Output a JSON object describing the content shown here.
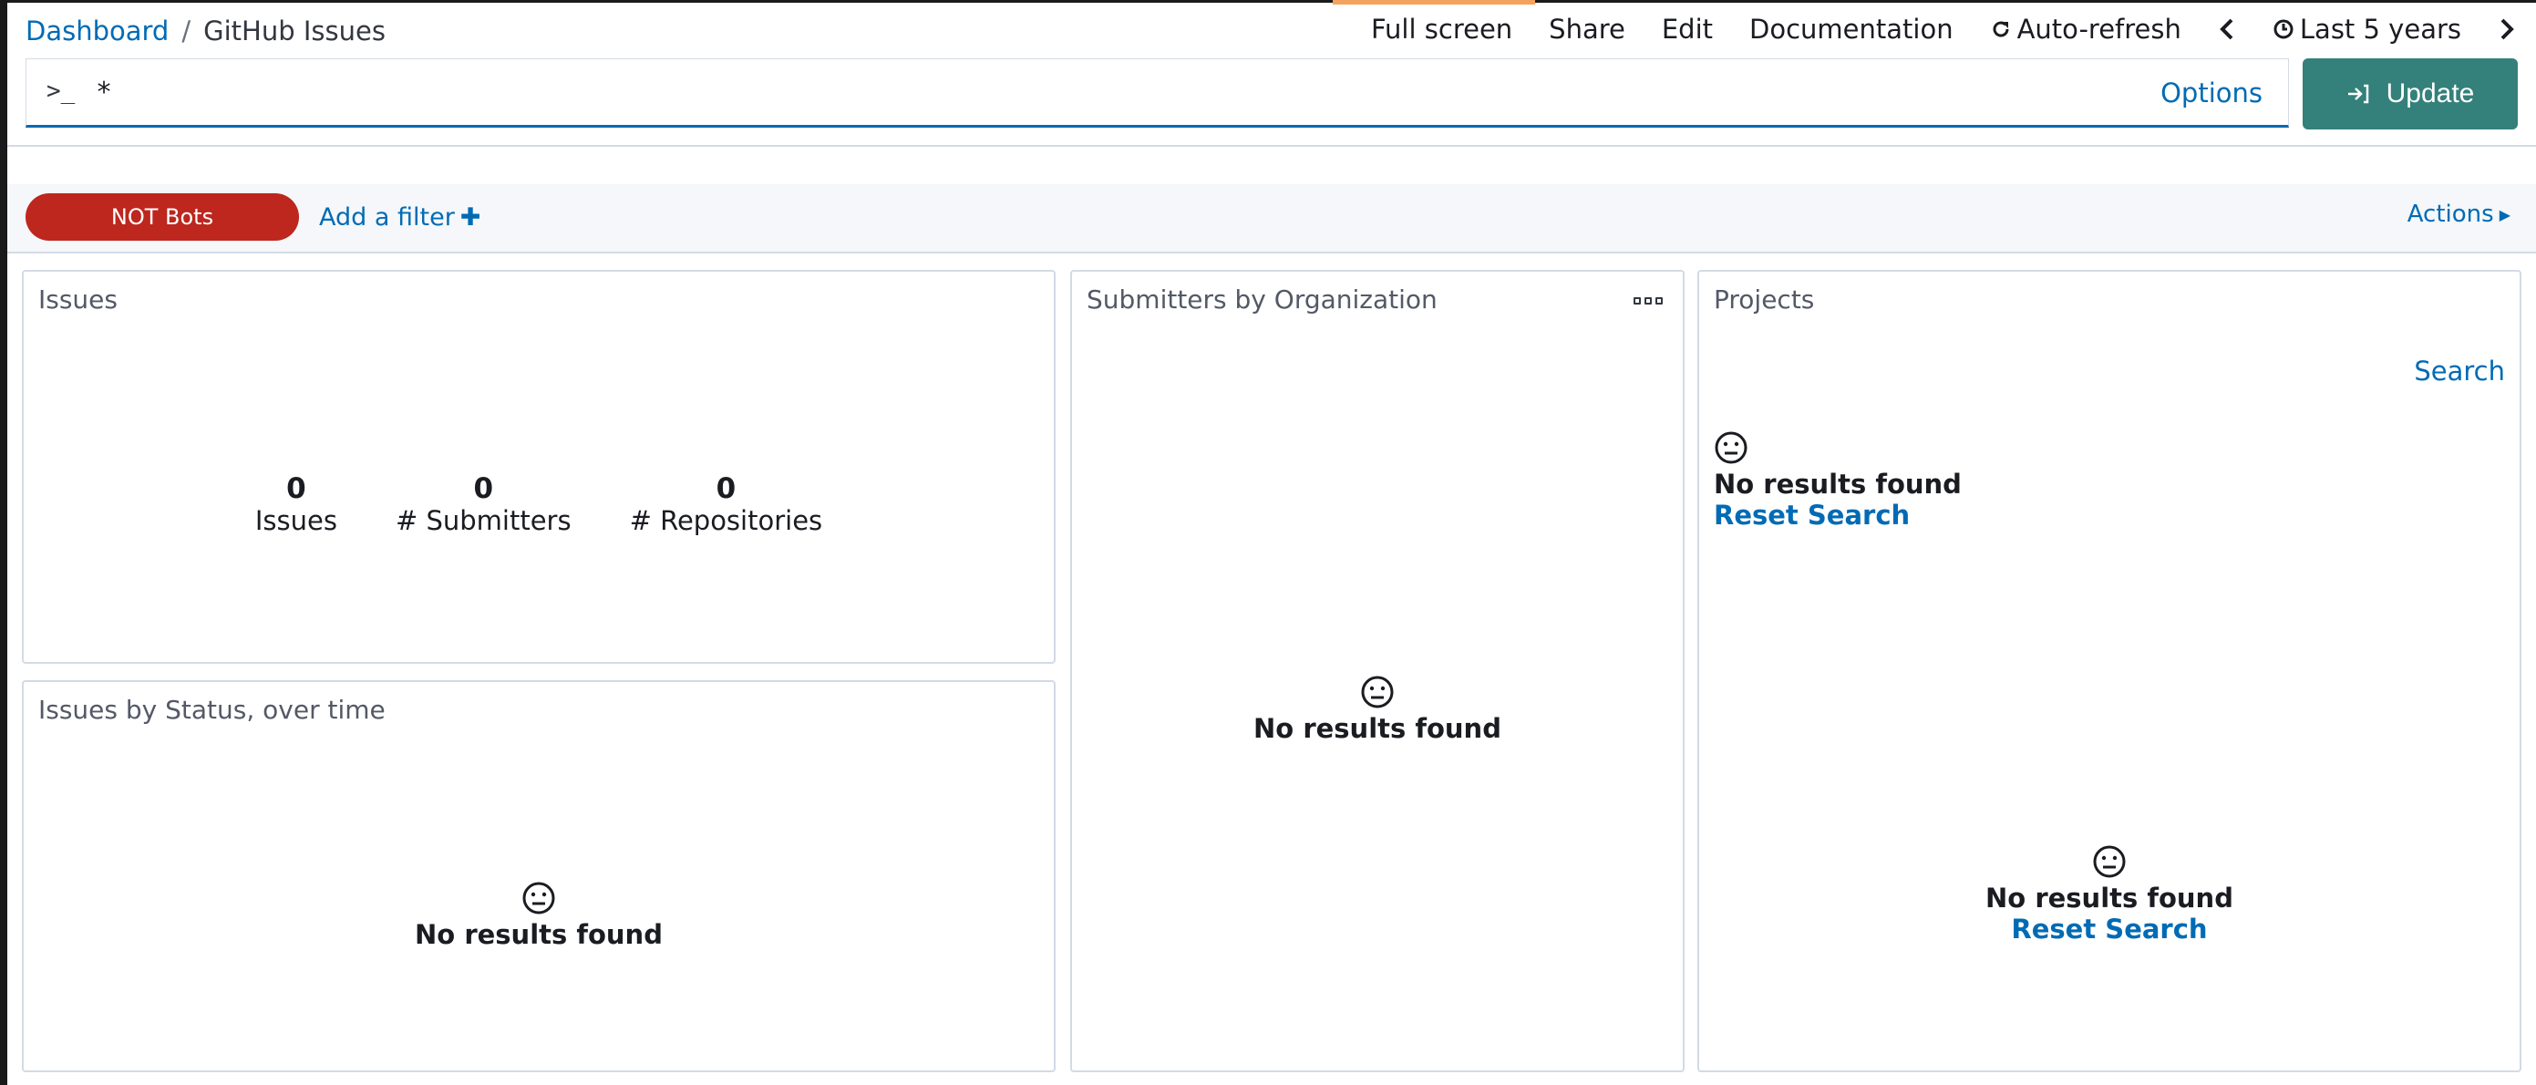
{
  "breadcrumb": {
    "root": "Dashboard",
    "separator": "/",
    "current": "GitHub Issues"
  },
  "topnav": {
    "full_screen": "Full screen",
    "share": "Share",
    "edit": "Edit",
    "documentation": "Documentation",
    "auto_refresh": "Auto-refresh",
    "time_range": "Last 5 years"
  },
  "query": {
    "prompt": ">_",
    "value": "*",
    "options": "Options",
    "update": "Update"
  },
  "filters": {
    "pills": [
      {
        "label": "NOT Bots",
        "color": "#bd271e"
      }
    ],
    "add_filter": "Add a filter",
    "actions": "Actions"
  },
  "panels": {
    "issues": {
      "title": "Issues",
      "metrics": [
        {
          "value": "0",
          "label": "Issues"
        },
        {
          "value": "0",
          "label": "# Submitters"
        },
        {
          "value": "0",
          "label": "# Repositories"
        }
      ]
    },
    "status": {
      "title": "Issues by Status, over time",
      "empty": "No results found"
    },
    "submitters": {
      "title": "Submitters by Organization",
      "empty": "No results found"
    },
    "projects": {
      "title": "Projects",
      "search": "Search",
      "empty_top": "No results found",
      "reset_top": "Reset Search",
      "empty_bottom": "No results found",
      "reset_bottom": "Reset Search"
    }
  },
  "colors": {
    "link": "#006bb4",
    "update_button": "#34807a",
    "filter_pill": "#bd271e",
    "loading_bar": "#f5a35c"
  }
}
